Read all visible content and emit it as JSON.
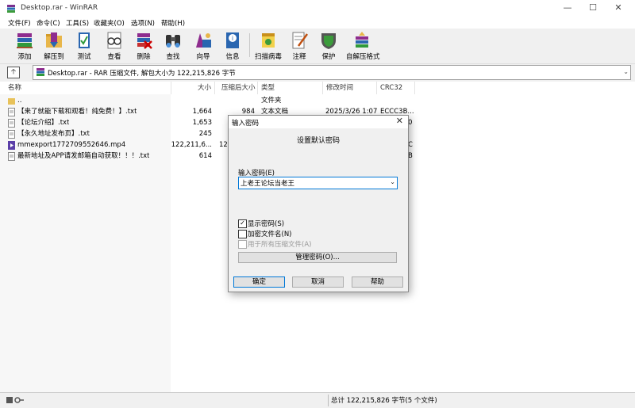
{
  "window": {
    "title": "Desktop.rar - WinRAR"
  },
  "menu": [
    "文件(F)",
    "命令(C)",
    "工具(S)",
    "收藏夹(O)",
    "选项(N)",
    "帮助(H)"
  ],
  "toolbar": [
    {
      "label": "添加",
      "icon": "books-add-icon"
    },
    {
      "label": "解压到",
      "icon": "extract-folder-icon"
    },
    {
      "label": "测试",
      "icon": "test-book-icon"
    },
    {
      "label": "查看",
      "icon": "glasses-view-icon"
    },
    {
      "label": "删除",
      "icon": "delete-books-icon"
    },
    {
      "label": "查找",
      "icon": "binoculars-find-icon"
    },
    {
      "label": "向导",
      "icon": "wizard-icon"
    },
    {
      "label": "信息",
      "icon": "info-icon"
    },
    {
      "label": "扫描病毒",
      "icon": "virus-scan-icon"
    },
    {
      "label": "注释",
      "icon": "comment-icon"
    },
    {
      "label": "保护",
      "icon": "shield-protect-icon"
    },
    {
      "label": "自解压格式",
      "icon": "sfx-icon"
    }
  ],
  "address": {
    "text": "Desktop.rar - RAR 压缩文件, 解包大小为 122,215,826 字节"
  },
  "columns": [
    "名称",
    "大小",
    "压缩后大小",
    "类型",
    "修改时间",
    "CRC32"
  ],
  "files": [
    {
      "name": "..",
      "size": "",
      "packed": "",
      "type": "文件夹",
      "modified": "",
      "crc": ""
    },
    {
      "name": "【来了就能下载和观看！纯免费！】.txt",
      "size": "1,664",
      "packed": "984",
      "type": "文本文档",
      "modified": "2025/3/26 1:07",
      "crc": "ECCC3B..."
    },
    {
      "name": "【论坛介绍】.txt",
      "size": "1,653",
      "packed": "",
      "type": "",
      "modified": "",
      "crc": "0"
    },
    {
      "name": "【永久地址发布页】.txt",
      "size": "245",
      "packed": "",
      "type": "",
      "modified": "",
      "crc": ""
    },
    {
      "name": "mmexport1772709552646.mp4",
      "size": "122,211,6...",
      "packed": "12",
      "type": "",
      "modified": "",
      "crc": "C"
    },
    {
      "name": "最新地址及APP请发邮箱自动获取！！！.txt",
      "size": "614",
      "packed": "",
      "type": "",
      "modified": "",
      "crc": "B"
    }
  ],
  "status": {
    "text": "总计 122,215,826 字节(5 个文件)"
  },
  "dialog": {
    "title": "输入密码",
    "heading": "设置默认密码",
    "password_label": "输入密码(E)",
    "password_value": "上老王论坛当老王",
    "show_password": "显示密码(S)",
    "encrypt_names": "加密文件名(N)",
    "all_archives": "用于所有压缩文件(A)",
    "manage_button": "管理密码(O)...",
    "ok": "确定",
    "cancel": "取消",
    "help": "帮助"
  }
}
